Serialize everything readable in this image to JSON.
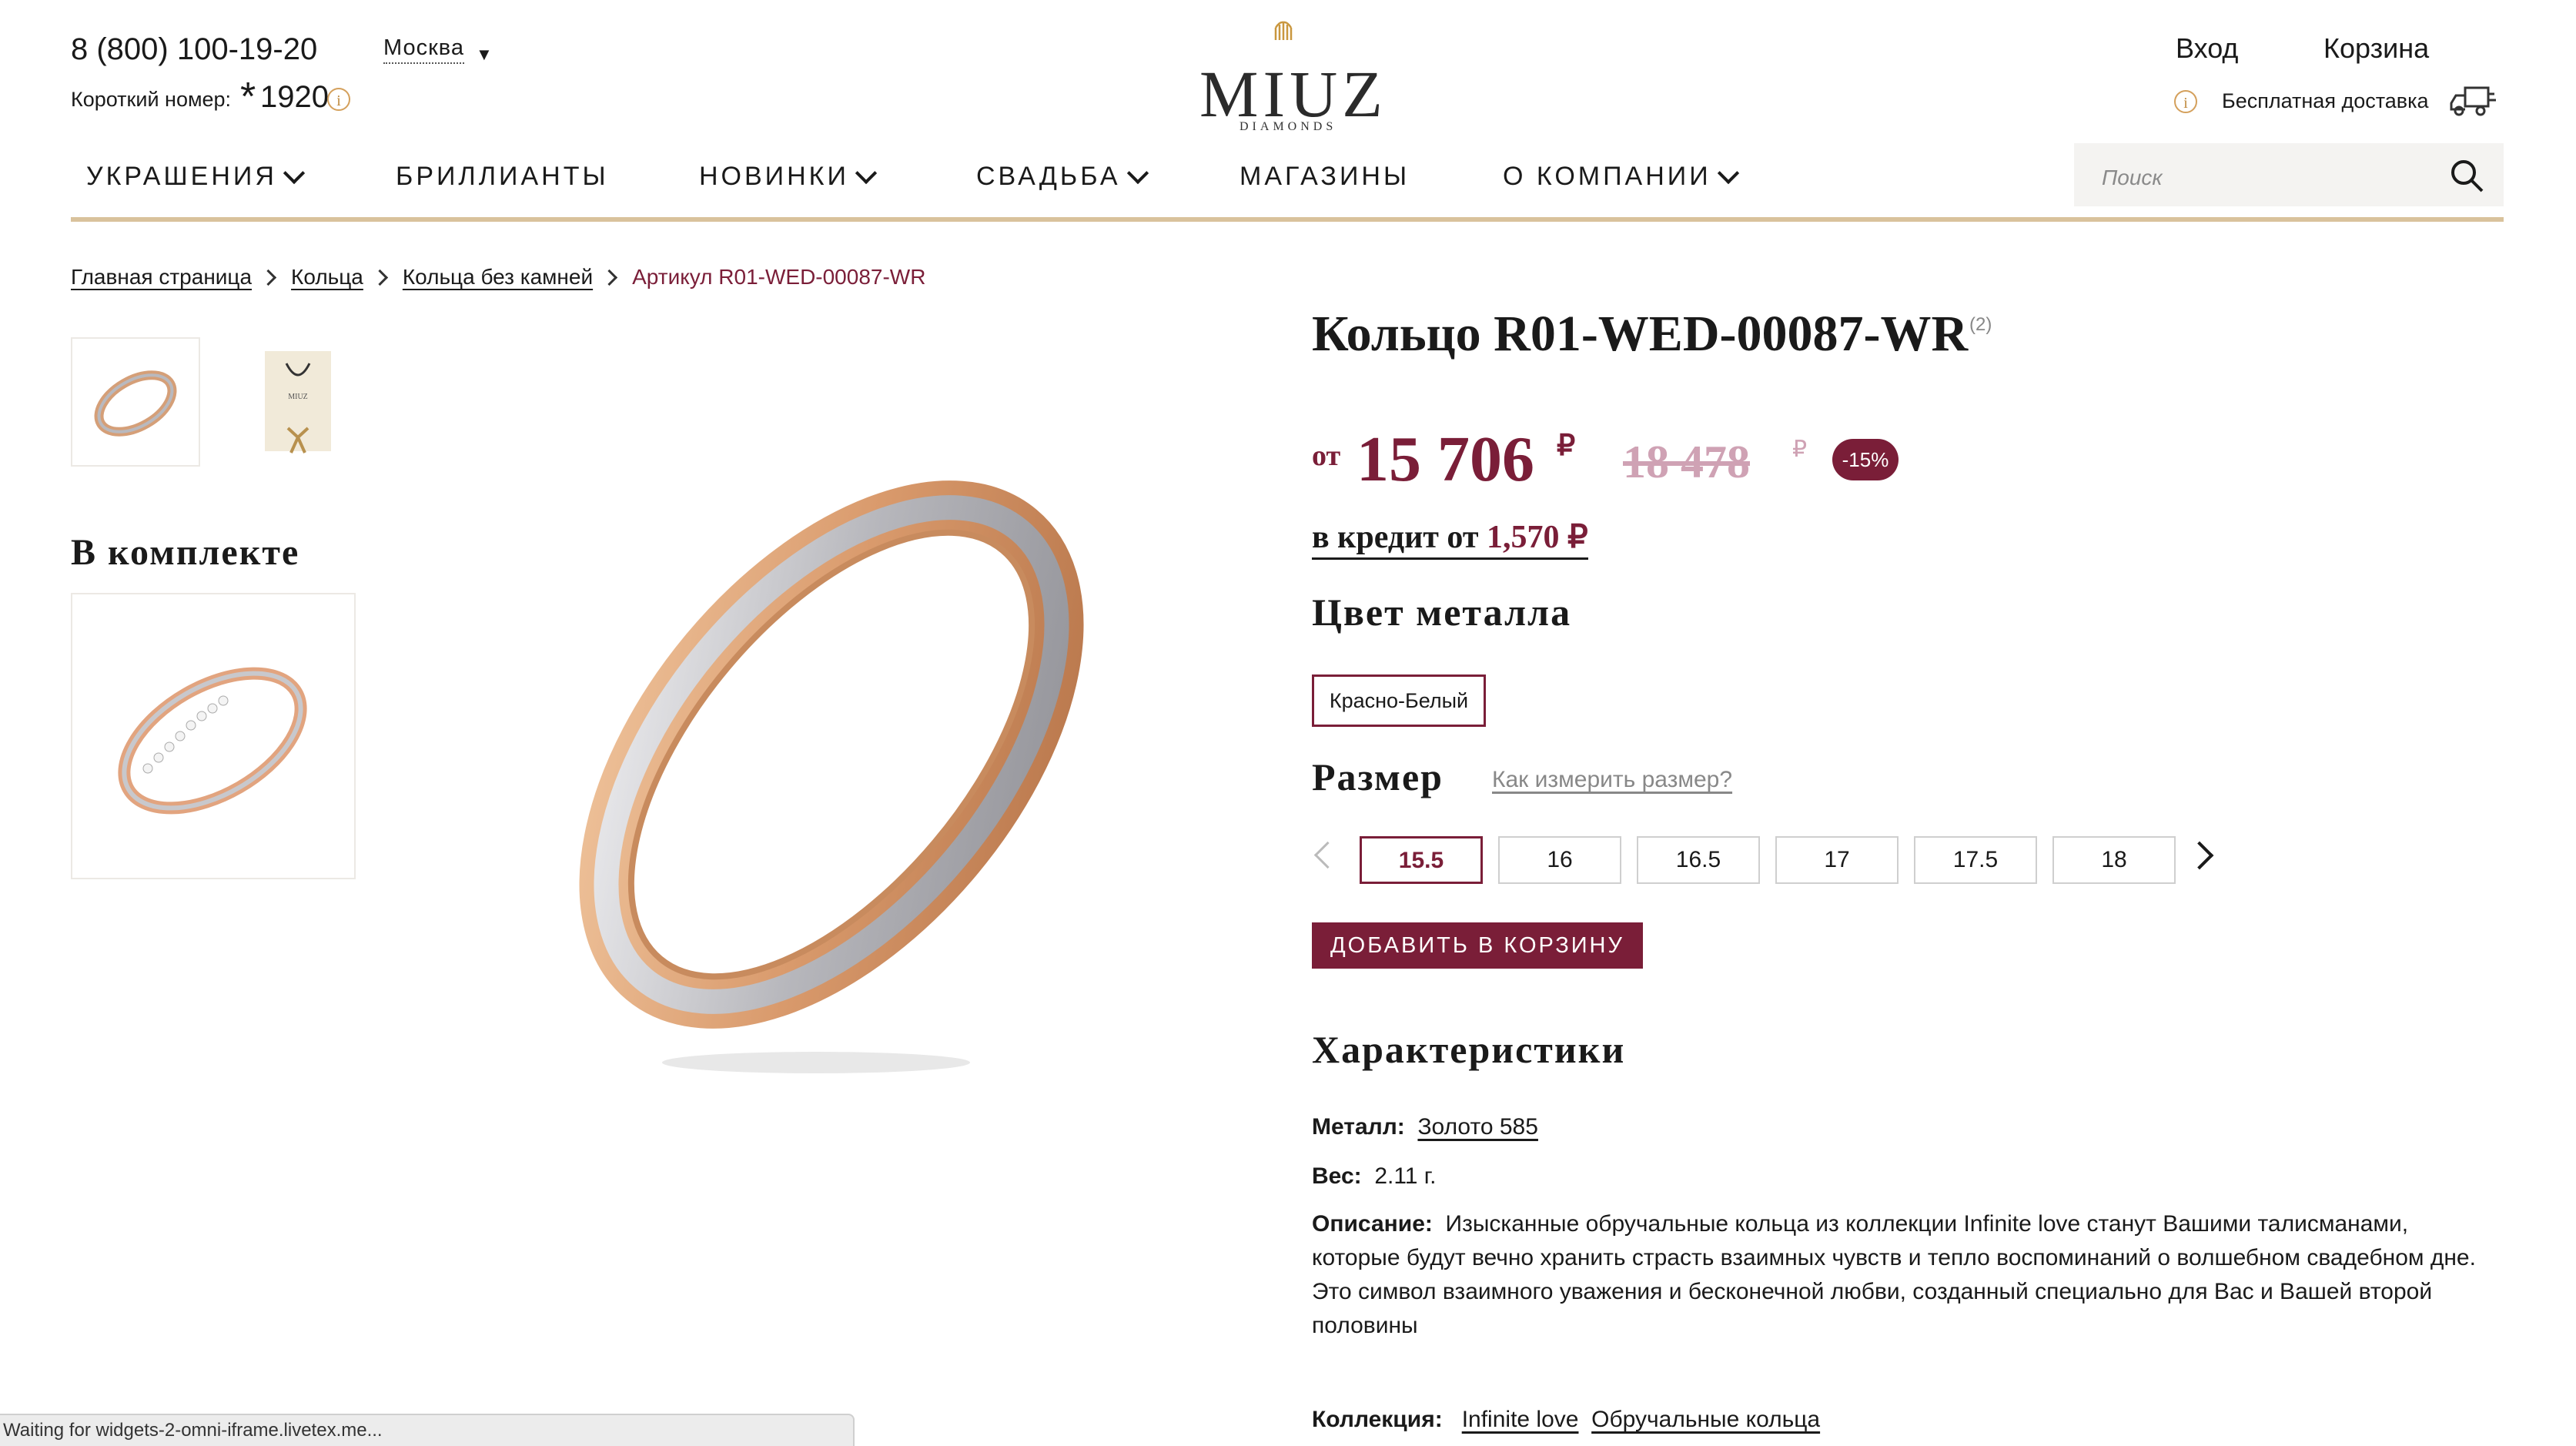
{
  "header": {
    "phone": "8 (800) 100-19-20",
    "city": "Москва",
    "short_label": "Короткий номер:",
    "short_star": "*",
    "short_number": "1920",
    "logo": "MIUZ",
    "logo_sub": "DIAMONDS",
    "login": "Вход",
    "cart": "Корзина",
    "delivery": "Бесплатная доставка"
  },
  "nav": {
    "items": [
      {
        "label": "УКРАШЕНИЯ"
      },
      {
        "label": "БРИЛЛИАНТЫ"
      },
      {
        "label": "НОВИНКИ"
      },
      {
        "label": "СВАДЬБА"
      },
      {
        "label": "МАГАЗИНЫ"
      },
      {
        "label": "О КОМПАНИИ"
      }
    ],
    "search_placeholder": "Поиск"
  },
  "breadcrumb": [
    "Главная страница",
    "Кольца",
    "Кольца без камней",
    "Артикул R01-WED-00087-WR"
  ],
  "kit_title": "В комплекте",
  "product": {
    "title": "Кольцо R01-WED-00087-WR",
    "reviews": "(2)",
    "price_prefix": "от",
    "price": "15 706",
    "currency": "₽",
    "old_price": "18 478",
    "discount": "-15%",
    "credit_label": "в кредит от",
    "credit_value": "1,570 ₽",
    "metal_title": "Цвет металла",
    "metal_option": "Красно-Белый",
    "size_title": "Размер",
    "size_help": "Как измерить размер?",
    "sizes": [
      "15.5",
      "16",
      "16.5",
      "17",
      "17.5",
      "18"
    ],
    "selected_size": "15.5",
    "add_to_cart": "ДОБАВИТЬ В КОРЗИНУ"
  },
  "specs": {
    "title": "Характеристики",
    "metal_label": "Металл:",
    "metal_value": "Золото 585",
    "weight_label": "Вес:",
    "weight_value": "2.11 г.",
    "desc_label": "Описание:",
    "desc_value": "Изысканные обручальные кольца из коллекции Infinite love станут Вашими талисманами, которые будут вечно хранить страсть взаимных чувств и тепло воспоминаний о волшебном свадебном дне. Это символ взаимного уважения и бесконечной любви, созданный специально для Вас и Вашей второй половины",
    "collection_label": "Коллекция:",
    "collection_values": [
      "Infinite love",
      "Обручальные кольца"
    ]
  },
  "status_bar": "Waiting for widgets-2-omni-iframe.livetex.me...",
  "colors": {
    "accent": "#7a1e38",
    "gold": "#d9c29c"
  }
}
